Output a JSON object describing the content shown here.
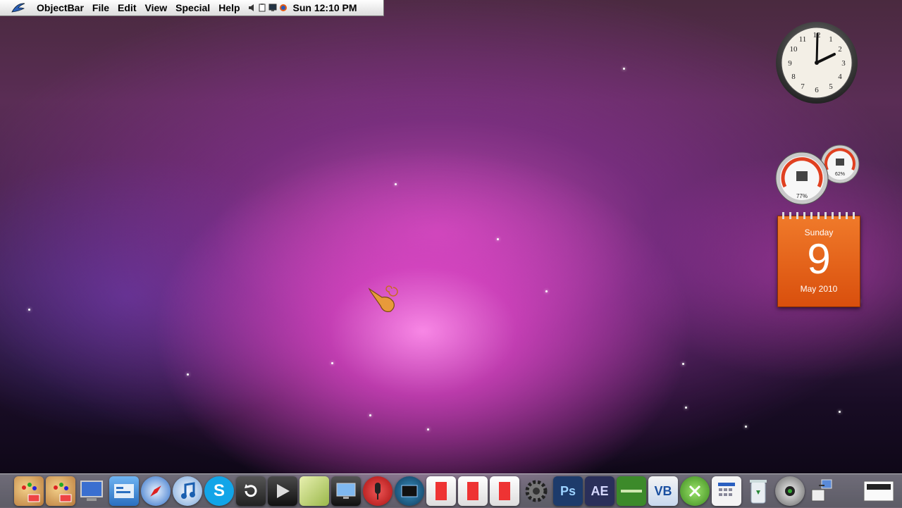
{
  "menubar": {
    "app_name": "ObjectBar",
    "menus": [
      "File",
      "Edit",
      "View",
      "Special",
      "Help"
    ],
    "clock": "Sun 12:10 PM"
  },
  "widgets": {
    "clock": {
      "hour_numbers": [
        "12",
        "1",
        "2",
        "3",
        "4",
        "5",
        "6",
        "7",
        "8",
        "9",
        "10",
        "11"
      ],
      "time": "2:01"
    },
    "cpu_gauge": {
      "label": "77%",
      "value": 0.77
    },
    "memory_gauge": {
      "label": "62%",
      "value": 0.62
    },
    "calendar": {
      "day_of_week": "Sunday",
      "day": "9",
      "month_year": "May 2010"
    }
  },
  "dock": {
    "items": [
      {
        "icon": "paint-palette-icon",
        "label": ""
      },
      {
        "icon": "paint-palette-icon",
        "label": ""
      },
      {
        "icon": "computer-icon",
        "label": ""
      },
      {
        "icon": "control-panel-icon",
        "label": ""
      },
      {
        "icon": "safari-compass-icon",
        "label": ""
      },
      {
        "icon": "itunes-icon",
        "label": ""
      },
      {
        "icon": "skype-icon",
        "label": "S"
      },
      {
        "icon": "refresh-icon",
        "label": ""
      },
      {
        "icon": "media-player-icon",
        "label": ""
      },
      {
        "icon": "notes-icon",
        "label": ""
      },
      {
        "icon": "monitor-icon",
        "label": ""
      },
      {
        "icon": "microphone-icon",
        "label": ""
      },
      {
        "icon": "screen-capture-icon",
        "label": ""
      },
      {
        "icon": "document-icon",
        "label": ""
      },
      {
        "icon": "document-icon",
        "label": ""
      },
      {
        "icon": "document-icon",
        "label": ""
      },
      {
        "icon": "settings-gear-icon",
        "label": ""
      },
      {
        "icon": "photoshop-icon",
        "label": "Ps"
      },
      {
        "icon": "after-effects-icon",
        "label": "AE"
      },
      {
        "icon": "equalizer-icon",
        "label": ""
      },
      {
        "icon": "visual-basic-icon",
        "label": "VB"
      },
      {
        "icon": "xbox-icon",
        "label": ""
      },
      {
        "icon": "calendar-grid-icon",
        "label": ""
      },
      {
        "icon": "recycle-bin-icon",
        "label": ""
      },
      {
        "icon": "camspace-icon",
        "label": ""
      },
      {
        "icon": "network-icon",
        "label": ""
      }
    ],
    "colors": {
      "photoshop": "#1d3b6b",
      "after_effects": "#2a2f5a",
      "skype": "#12a5e8",
      "xbox": "#4aa32c",
      "equalizer": "#3c8a2a"
    }
  }
}
